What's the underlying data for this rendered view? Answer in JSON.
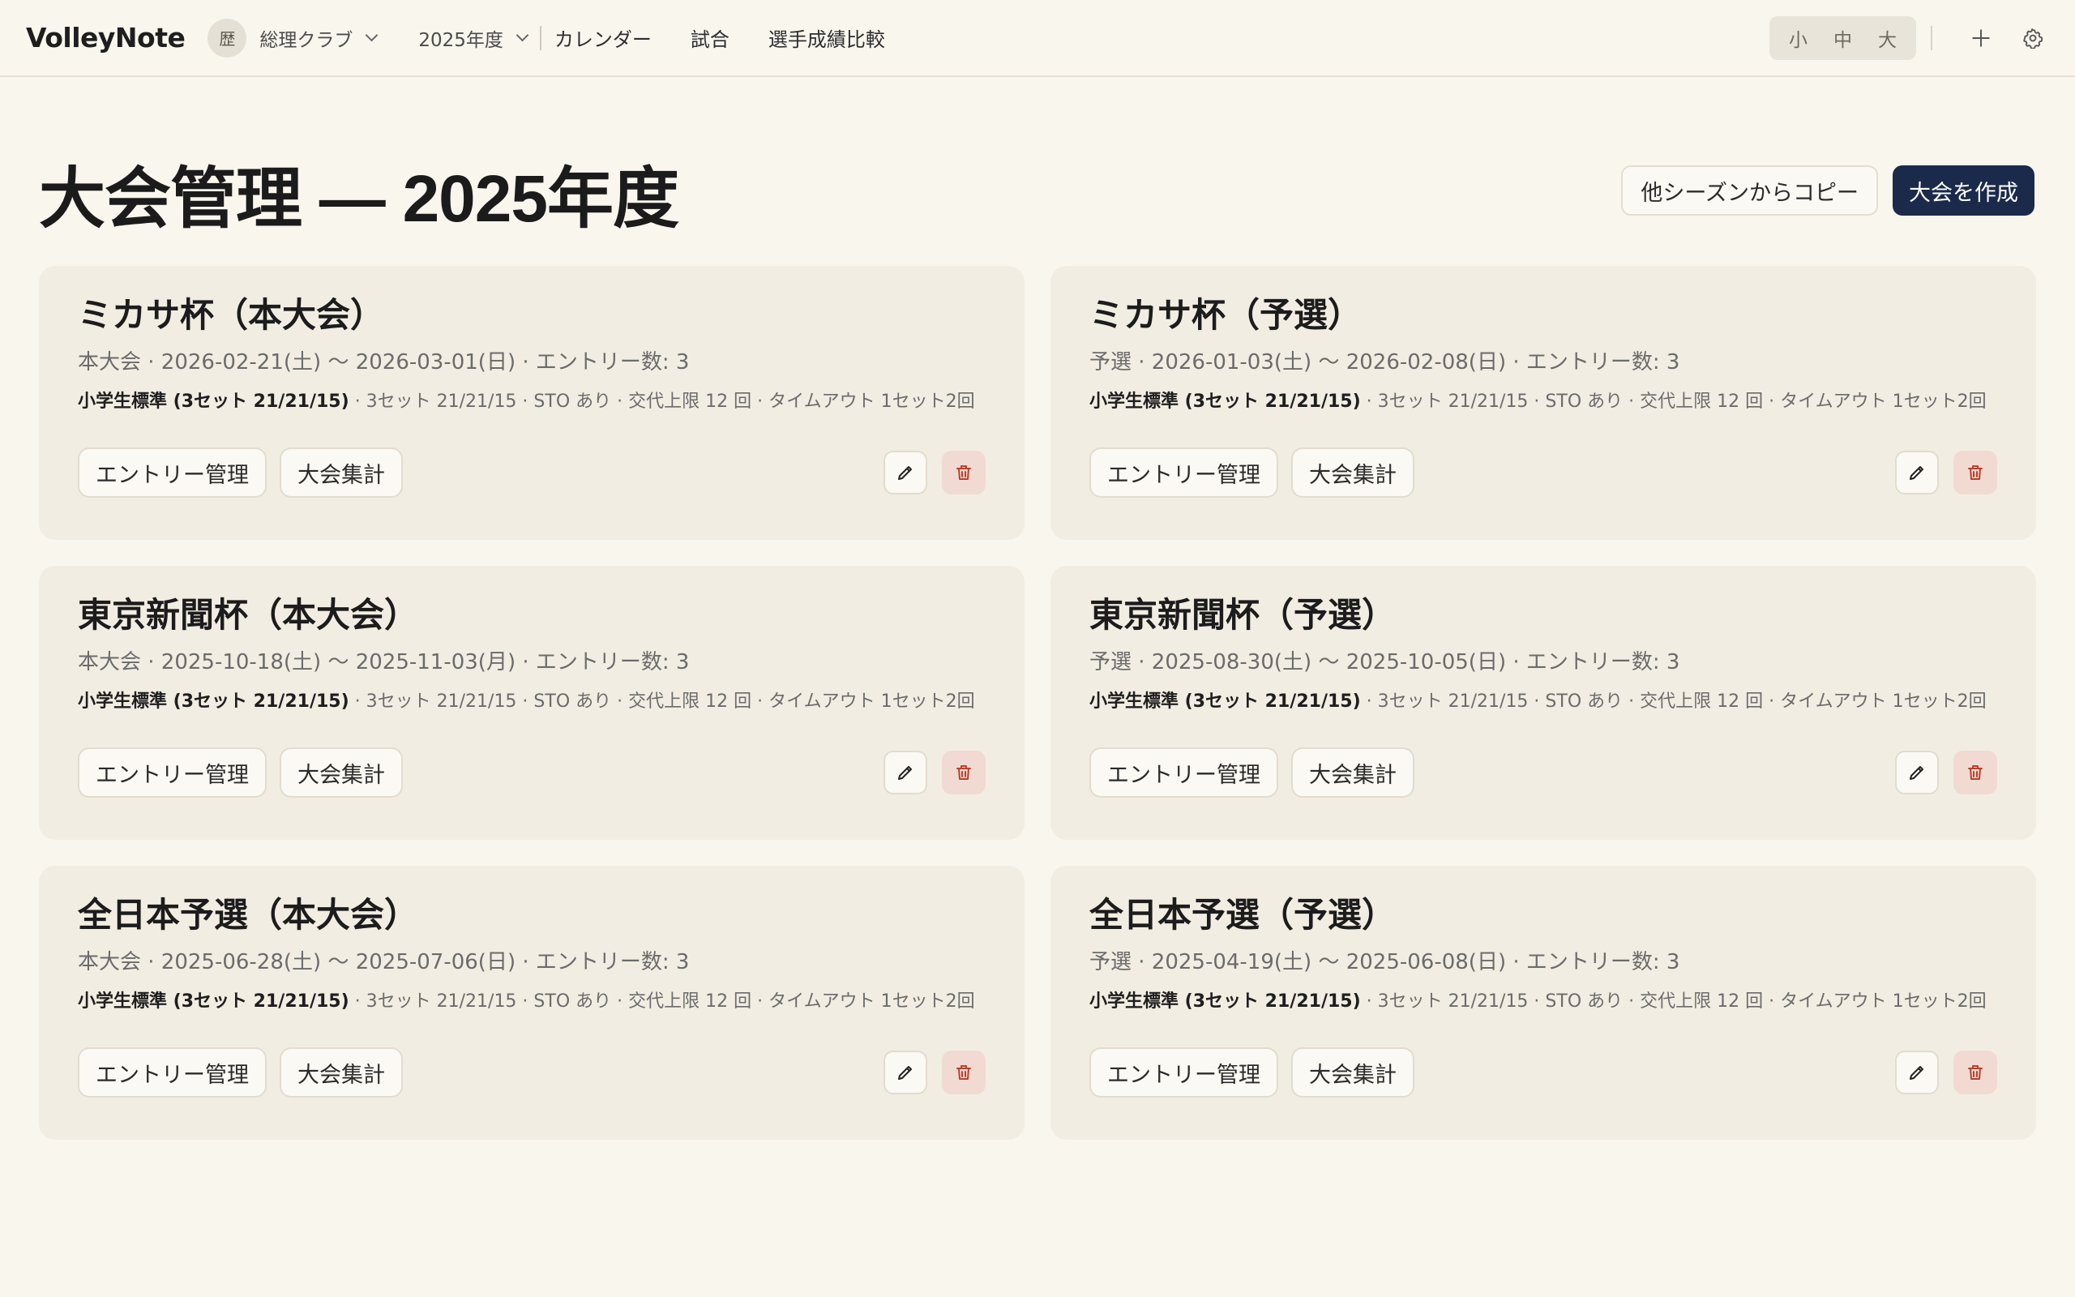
{
  "app": {
    "brand": "VolleyNote"
  },
  "nav": {
    "club_badge": "歴",
    "club": "総理クラブ",
    "season": "2025年度",
    "links": [
      "カレンダー",
      "試合",
      "選手成績比較"
    ]
  },
  "font_size_toggle": {
    "options": [
      "小",
      "中",
      "大"
    ]
  },
  "header": {
    "title": "大会管理 — 2025年度",
    "copy_button": "他シーズンからコピー",
    "create_button": "大会を作成"
  },
  "card_buttons": {
    "entry": "エントリー管理",
    "summary": "大会集計"
  },
  "colors": {
    "primary": "#1b2a4a",
    "background": "#f9f6ee",
    "card": "#f2ede2",
    "danger": "#b8412e"
  },
  "tournaments": [
    {
      "title": "ミカサ杯（本大会）",
      "subtitle": "本大会 · 2026-02-21(土) 〜 2026-03-01(日) · エントリー数: 3",
      "rule_name": "小学生標準 (3セット 21/21/15)",
      "rule_detail": " · 3セット 21/21/15 · STO あり · 交代上限 12 回 · タイムアウト 1セット2回"
    },
    {
      "title": "ミカサ杯（予選）",
      "subtitle": "予選 · 2026-01-03(土) 〜 2026-02-08(日) · エントリー数: 3",
      "rule_name": "小学生標準 (3セット 21/21/15)",
      "rule_detail": " · 3セット 21/21/15 · STO あり · 交代上限 12 回 · タイムアウト 1セット2回"
    },
    {
      "title": "東京新聞杯（本大会）",
      "subtitle": "本大会 · 2025-10-18(土) 〜 2025-11-03(月) · エントリー数: 3",
      "rule_name": "小学生標準 (3セット 21/21/15)",
      "rule_detail": " · 3セット 21/21/15 · STO あり · 交代上限 12 回 · タイムアウト 1セット2回"
    },
    {
      "title": "東京新聞杯（予選）",
      "subtitle": "予選 · 2025-08-30(土) 〜 2025-10-05(日) · エントリー数: 3",
      "rule_name": "小学生標準 (3セット 21/21/15)",
      "rule_detail": " · 3セット 21/21/15 · STO あり · 交代上限 12 回 · タイムアウト 1セット2回"
    },
    {
      "title": "全日本予選（本大会）",
      "subtitle": "本大会 · 2025-06-28(土) 〜 2025-07-06(日) · エントリー数: 3",
      "rule_name": "小学生標準 (3セット 21/21/15)",
      "rule_detail": " · 3セット 21/21/15 · STO あり · 交代上限 12 回 · タイムアウト 1セット2回"
    },
    {
      "title": "全日本予選（予選）",
      "subtitle": "予選 · 2025-04-19(土) 〜 2025-06-08(日) · エントリー数: 3",
      "rule_name": "小学生標準 (3セット 21/21/15)",
      "rule_detail": " · 3セット 21/21/15 · STO あり · 交代上限 12 回 · タイムアウト 1セット2回"
    }
  ]
}
